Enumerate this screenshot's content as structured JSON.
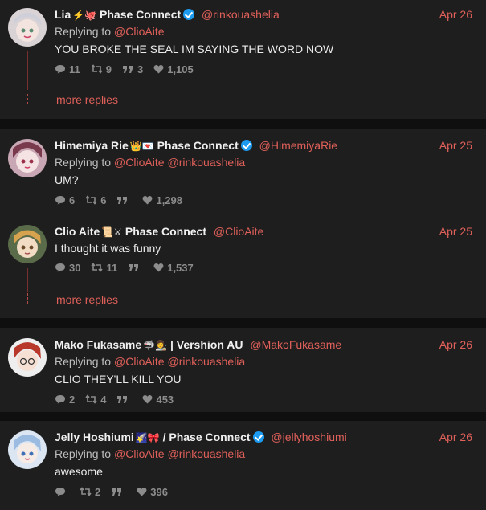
{
  "colors": {
    "accent": "#e0605a",
    "thread_line": "#7a2f2f",
    "verified": "#1d9bf0",
    "card_bg": "#1e1e1e",
    "page_bg": "#0f0f0f"
  },
  "tweets": [
    {
      "name": "Lia",
      "emoji": "⚡🐙",
      "affiliation": "Phase Connect",
      "verified": true,
      "handle": "@rinkouashelia",
      "date": "Apr 26",
      "replying_label": "Replying to",
      "replying_to": [
        "@ClioAite"
      ],
      "text": "YOU BROKE THE SEAL IM SAYING THE WORD NOW",
      "stats": {
        "replies": "11",
        "retweets": "9",
        "quotes": "3",
        "likes": "1,105"
      }
    },
    {
      "name": "Himemiya Rie",
      "emoji": "👑💌",
      "affiliation": "Phase Connect",
      "verified": true,
      "handle": "@HimemiyaRie",
      "date": "Apr 25",
      "replying_label": "Replying to",
      "replying_to": [
        "@ClioAite",
        "@rinkouashelia"
      ],
      "text": "UM?",
      "stats": {
        "replies": "6",
        "retweets": "6",
        "quotes": "",
        "likes": "1,298"
      }
    },
    {
      "name": "Clio Aite",
      "emoji": "📜⚔",
      "affiliation": "Phase Connect",
      "verified": false,
      "handle": "@ClioAite",
      "date": "Apr 25",
      "text": "I thought it was funny",
      "stats": {
        "replies": "30",
        "retweets": "11",
        "quotes": "",
        "likes": "1,537"
      }
    },
    {
      "name": "Mako Fukasame",
      "emoji": "🦈👩‍🎨",
      "affiliation": "| Vershion AU",
      "verified": false,
      "handle": "@MakoFukasame",
      "date": "Apr 26",
      "replying_label": "Replying to",
      "replying_to": [
        "@ClioAite",
        "@rinkouashelia"
      ],
      "text": "CLIO THEY'LL KILL YOU",
      "stats": {
        "replies": "2",
        "retweets": "4",
        "quotes": "",
        "likes": "453"
      }
    },
    {
      "name": "Jelly Hoshiumi",
      "emoji": "🌠🎀",
      "affiliation": "/ Phase Connect",
      "verified": true,
      "handle": "@jellyhoshiumi",
      "date": "Apr 26",
      "replying_label": "Replying to",
      "replying_to": [
        "@ClioAite",
        "@rinkouashelia"
      ],
      "text": "awesome",
      "stats": {
        "replies": "",
        "retweets": "2",
        "quotes": "",
        "likes": "396"
      }
    }
  ],
  "more_replies_label": "more replies"
}
